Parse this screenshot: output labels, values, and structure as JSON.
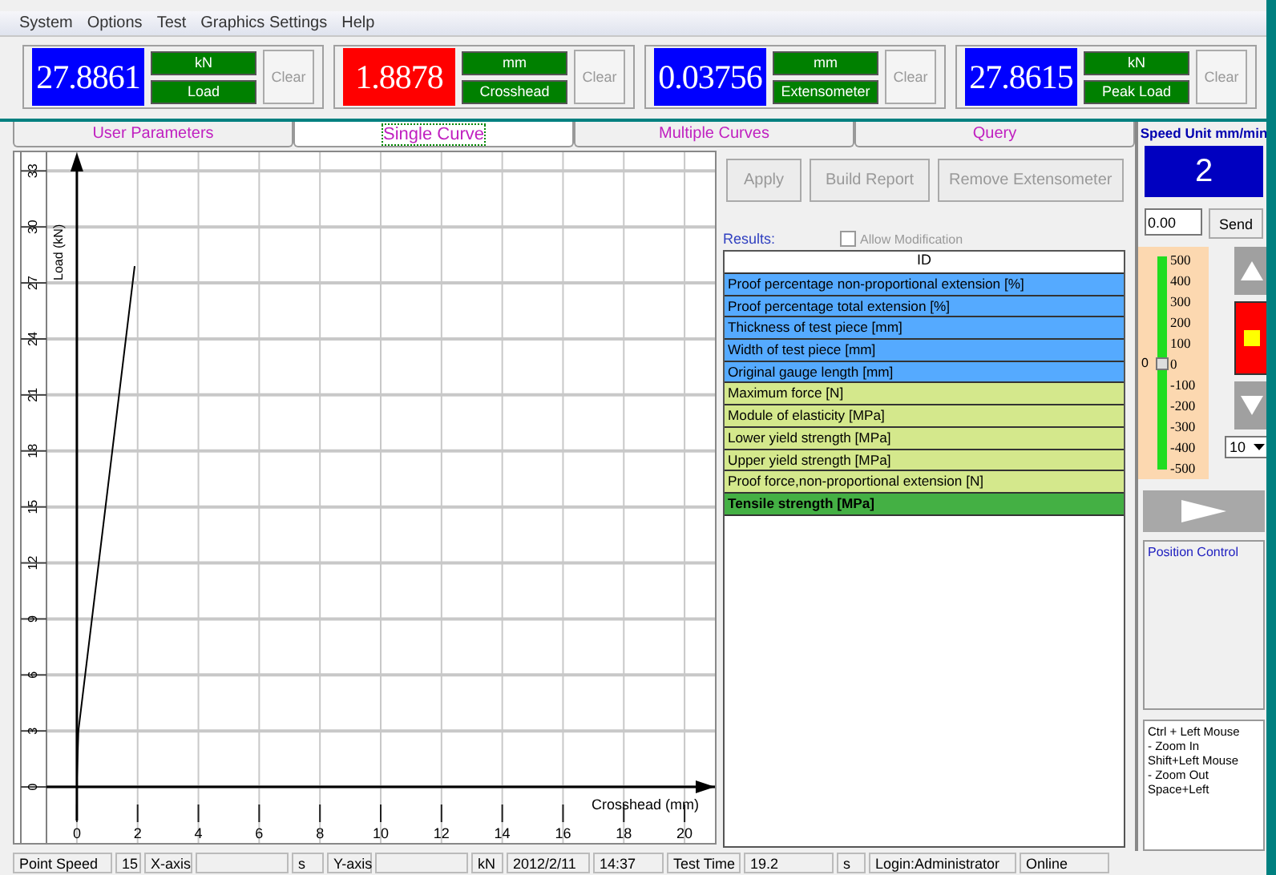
{
  "menu": [
    "System",
    "Options",
    "Test",
    "Graphics Settings",
    "Help"
  ],
  "displays": [
    {
      "value": "27.8861",
      "color": "#0000ff",
      "unit": "kN",
      "label": "Load",
      "clear": "Clear"
    },
    {
      "value": "1.8878",
      "color": "#ff0000",
      "unit": "mm",
      "label": "Crosshead",
      "clear": "Clear"
    },
    {
      "value": "0.03756",
      "color": "#0000ff",
      "unit": "mm",
      "label": "Extensometer",
      "clear": "Clear"
    },
    {
      "value": "27.8615",
      "color": "#0000ff",
      "unit": "kN",
      "label": "Peak Load",
      "clear": "Clear"
    }
  ],
  "tabs": [
    {
      "label": "User Parameters",
      "selected": false
    },
    {
      "label": "Single Curve",
      "selected": true
    },
    {
      "label": "Multiple Curves",
      "selected": false
    },
    {
      "label": "Query",
      "selected": false
    }
  ],
  "chart": {
    "chart_data": {
      "type": "line",
      "grid": true,
      "xlabel": "Crosshead (mm)",
      "ylabel": "Load (kN)",
      "x": [
        0,
        0.05,
        1.9
      ],
      "series": [
        {
          "color": "#000000",
          "values": [
            0.5,
            3,
            27.9
          ]
        }
      ],
      "xlim": [
        -1,
        21
      ],
      "ylim": [
        -3,
        34
      ],
      "xticks": [
        0,
        2,
        4,
        6,
        8,
        10,
        12,
        14,
        16,
        18,
        20
      ],
      "yticks": [
        0,
        3,
        6,
        9,
        12,
        15,
        18,
        21,
        24,
        27,
        30,
        33
      ]
    }
  },
  "actions": [
    {
      "label": "Apply",
      "disabled": true
    },
    {
      "label": "Build Report",
      "disabled": true
    },
    {
      "label": "Remove Extensometer",
      "disabled": true
    }
  ],
  "results": {
    "title": "Results:",
    "allow_modification": {
      "label": "Allow Modification",
      "checked": false,
      "disabled": true
    },
    "header": "ID",
    "rows": [
      {
        "text": "Proof percentage non-proportional extension  [%]",
        "color": "#55aaff",
        "emphasized": false
      },
      {
        "text": "Proof percentage total extension  [%]",
        "color": "#55aaff",
        "emphasized": false
      },
      {
        "text": "Thickness of test piece  [mm]",
        "color": "#55aaff",
        "emphasized": false
      },
      {
        "text": "Width of test piece  [mm]",
        "color": "#55aaff",
        "emphasized": false
      },
      {
        "text": "Original gauge length  [mm]",
        "color": "#55aaff",
        "emphasized": false
      },
      {
        "text": "Maximum force  [N]",
        "color": "#d4e88c",
        "emphasized": false
      },
      {
        "text": "Module of elasticity  [MPa]",
        "color": "#d4e88c",
        "emphasized": false
      },
      {
        "text": "Lower yield strength  [MPa]",
        "color": "#d4e88c",
        "emphasized": false
      },
      {
        "text": "Upper yield strength  [MPa]",
        "color": "#d4e88c",
        "emphasized": false
      },
      {
        "text": "Proof force,non-proportional extension  [N]",
        "color": "#d4e88c",
        "emphasized": false
      },
      {
        "text": "Tensile strength  [MPa]",
        "color": "#44b044",
        "emphasized": true
      }
    ]
  },
  "side": {
    "speed_title": "Speed Unit mm/min",
    "speed": "2",
    "input": "0.00",
    "send": "Send",
    "gauge": {
      "zero_label": "0",
      "level": 0.5,
      "scale": [
        "500",
        "400",
        "300",
        "200",
        "100",
        "0",
        "-100",
        "-200",
        "-300",
        "-400",
        "-500"
      ]
    },
    "step": "10",
    "position_title": "Position Control",
    "help": [
      "Ctrl + Left Mouse",
      "- Zoom In",
      "Shift+Left Mouse",
      "- Zoom Out",
      "Space+Left"
    ]
  },
  "status_bar": [
    "Point Speed",
    "15",
    "X-axis",
    "s",
    "Y-axis",
    "kN",
    "2012/2/11",
    "14:37",
    "Test Time",
    "19.2",
    "s",
    "Login:Administrator",
    "Online"
  ]
}
